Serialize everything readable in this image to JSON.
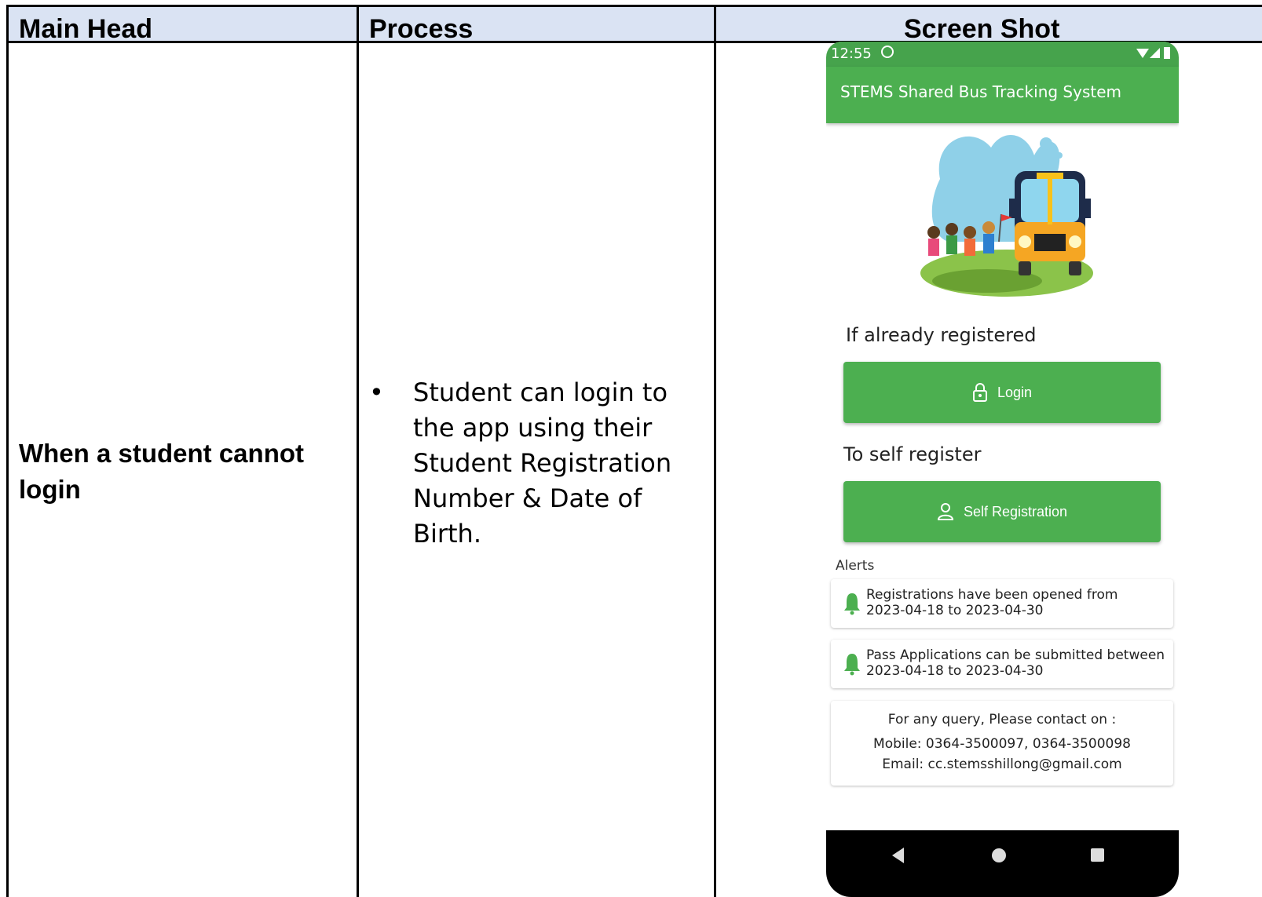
{
  "table": {
    "headers": [
      "Main Head",
      "Process",
      "Screen Shot"
    ],
    "main_head": "When a student cannot login",
    "process_bullet": "•",
    "process_text": "Student can login to the app using their Student Registration Number & Date of Birth."
  },
  "phone": {
    "status_time": "12:55",
    "app_title": "STEMS Shared Bus Tracking System",
    "registered_label": "If already registered",
    "login_button": "Login",
    "self_register_label": "To self register",
    "self_registration_button": "Self Registration",
    "alerts_title": "Alerts",
    "alerts": [
      {
        "line1": "Registrations have been opened from",
        "line2": "2023-04-18 to 2023-04-30"
      },
      {
        "line1": "Pass Applications can be submitted between",
        "line2": "2023-04-18 to 2023-04-30"
      }
    ],
    "contact": {
      "heading": "For any query, Please contact on :",
      "mobile": "Mobile: 0364-3500097, 0364-3500098",
      "email": "Email: cc.stemsshillong@gmail.com"
    },
    "colors": {
      "primary": "#4caf50",
      "header_fill": "#dae3f3"
    }
  }
}
